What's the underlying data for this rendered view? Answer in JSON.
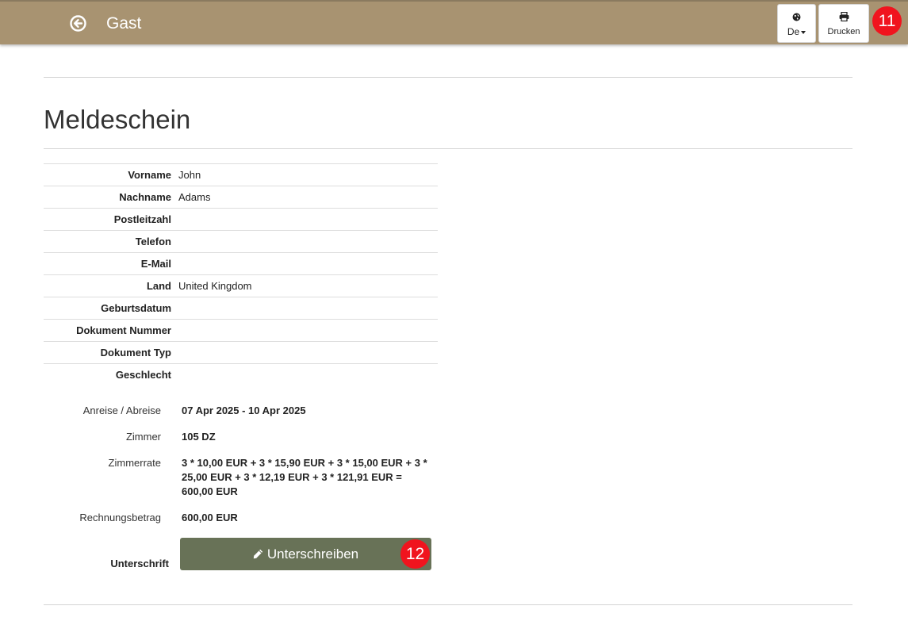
{
  "header": {
    "title": "Gast",
    "language_label": "De",
    "print_label": "Drucken",
    "icons": {
      "back": "circle-arrow-left-icon",
      "language": "globe-icon",
      "print": "printer-icon"
    }
  },
  "annotations": {
    "header_badge": "11",
    "sign_badge": "12"
  },
  "page": {
    "title": "Meldeschein"
  },
  "guest_fields": [
    {
      "label": "Vorname",
      "value": "John"
    },
    {
      "label": "Nachname",
      "value": "Adams"
    },
    {
      "label": "Postleitzahl",
      "value": ""
    },
    {
      "label": "Telefon",
      "value": ""
    },
    {
      "label": "E-Mail",
      "value": ""
    },
    {
      "label": "Land",
      "value": "United Kingdom"
    },
    {
      "label": "Geburtsdatum",
      "value": ""
    },
    {
      "label": "Dokument Nummer",
      "value": ""
    },
    {
      "label": "Dokument Typ",
      "value": ""
    },
    {
      "label": "Geschlecht",
      "value": ""
    }
  ],
  "stay": {
    "arrival_label": "Anreise / Abreise",
    "arrival_value": "07 Apr 2025 - 10 Apr 2025",
    "room_label": "Zimmer",
    "room_value": "105 DZ",
    "rate_label": "Zimmerrate",
    "rate_value": "3 * 10,00 EUR + 3 * 15,90 EUR + 3 * 15,00 EUR + 3 * 25,00 EUR + 3 * 12,19 EUR + 3 * 121,91 EUR = 600,00 EUR",
    "invoice_label": "Rechnungsbetrag",
    "invoice_value": "600,00 EUR"
  },
  "signature": {
    "label": "Unterschrift",
    "button_label": "Unterschreiben",
    "icon": "pencil-icon"
  },
  "colors": {
    "header_bg": "#a89371",
    "sign_button": "#687257",
    "badge": "#f0141e"
  }
}
